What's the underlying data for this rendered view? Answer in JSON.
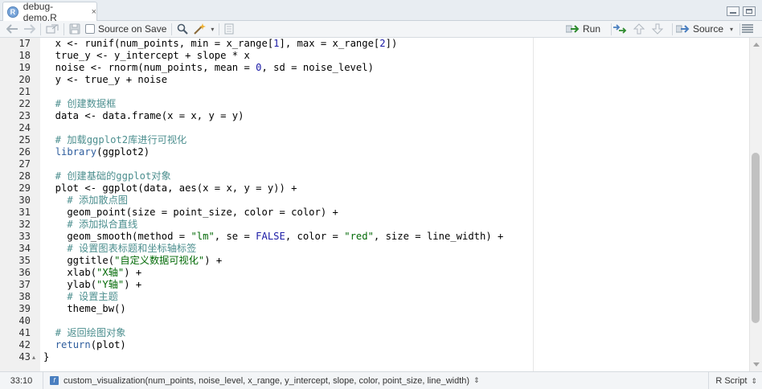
{
  "tab": {
    "file_icon": "R",
    "title": "debug-demo.R",
    "close": "×"
  },
  "toolbar": {
    "source_on_save_label": "Source on Save",
    "run_label": "Run",
    "source_label": "Source"
  },
  "icons": {
    "back": "back-arrow-icon",
    "forward": "forward-arrow-icon",
    "show_in_window": "show-in-window-icon",
    "save": "save-icon",
    "search": "search-icon",
    "code_tools": "magic-wand-icon",
    "compile_report": "notebook-icon",
    "rerun": "rerun-icon",
    "go_up": "go-to-previous-section-icon",
    "go_down": "go-to-next-section-icon"
  },
  "editor": {
    "lines": [
      {
        "n": "17",
        "tokens": [
          [
            "p",
            "  x <- runif(num_points, min = x_range["
          ],
          [
            "n",
            "1"
          ],
          [
            "p",
            "], max = x_range["
          ],
          [
            "n",
            "2"
          ],
          [
            "p",
            "])"
          ]
        ]
      },
      {
        "n": "18",
        "tokens": [
          [
            "p",
            "  true_y <- y_intercept + slope * x"
          ]
        ]
      },
      {
        "n": "19",
        "tokens": [
          [
            "p",
            "  noise <- rnorm(num_points, mean = "
          ],
          [
            "n",
            "0"
          ],
          [
            "p",
            ", sd = noise_level)"
          ]
        ]
      },
      {
        "n": "20",
        "tokens": [
          [
            "p",
            "  y <- true_y + noise"
          ]
        ]
      },
      {
        "n": "21",
        "tokens": []
      },
      {
        "n": "22",
        "tokens": [
          [
            "c",
            "  # 创建数据框"
          ]
        ]
      },
      {
        "n": "23",
        "tokens": [
          [
            "p",
            "  data <- data.frame(x = x, y = y)"
          ]
        ]
      },
      {
        "n": "24",
        "tokens": []
      },
      {
        "n": "25",
        "tokens": [
          [
            "c",
            "  # 加载ggplot2库进行可视化"
          ]
        ]
      },
      {
        "n": "26",
        "tokens": [
          [
            "p",
            "  "
          ],
          [
            "k",
            "library"
          ],
          [
            "p",
            "(ggplot2)"
          ]
        ]
      },
      {
        "n": "27",
        "tokens": []
      },
      {
        "n": "28",
        "tokens": [
          [
            "c",
            "  # 创建基础的ggplot对象"
          ]
        ]
      },
      {
        "n": "29",
        "tokens": [
          [
            "p",
            "  plot <- ggplot(data, aes(x = x, y = y)) +"
          ]
        ]
      },
      {
        "n": "30",
        "tokens": [
          [
            "c",
            "    # 添加散点图"
          ]
        ]
      },
      {
        "n": "31",
        "tokens": [
          [
            "p",
            "    geom_point(size = point_size, color = color) +"
          ]
        ]
      },
      {
        "n": "32",
        "tokens": [
          [
            "c",
            "    # 添加拟合直线"
          ]
        ]
      },
      {
        "n": "33",
        "tokens": [
          [
            "p",
            "    geom_smooth(method = "
          ],
          [
            "s",
            "\"lm\""
          ],
          [
            "p",
            ", se = "
          ],
          [
            "n",
            "FALSE"
          ],
          [
            "p",
            ", color = "
          ],
          [
            "s",
            "\"red\""
          ],
          [
            "p",
            ", size = line_width) +"
          ]
        ]
      },
      {
        "n": "34",
        "tokens": [
          [
            "c",
            "    # 设置图表标题和坐标轴标签"
          ]
        ]
      },
      {
        "n": "35",
        "tokens": [
          [
            "p",
            "    ggtitle("
          ],
          [
            "s",
            "\"自定义数据可视化\""
          ],
          [
            "p",
            ") +"
          ]
        ]
      },
      {
        "n": "36",
        "tokens": [
          [
            "p",
            "    xlab("
          ],
          [
            "s",
            "\"X轴\""
          ],
          [
            "p",
            ") +"
          ]
        ]
      },
      {
        "n": "37",
        "tokens": [
          [
            "p",
            "    ylab("
          ],
          [
            "s",
            "\"Y轴\""
          ],
          [
            "p",
            ") +"
          ]
        ]
      },
      {
        "n": "38",
        "tokens": [
          [
            "c",
            "    # 设置主题"
          ]
        ]
      },
      {
        "n": "39",
        "tokens": [
          [
            "p",
            "    theme_bw()"
          ]
        ]
      },
      {
        "n": "40",
        "tokens": []
      },
      {
        "n": "41",
        "tokens": [
          [
            "c",
            "  # 返回绘图对象"
          ]
        ]
      },
      {
        "n": "42",
        "tokens": [
          [
            "p",
            "  "
          ],
          [
            "k",
            "return"
          ],
          [
            "p",
            "(plot)"
          ]
        ]
      },
      {
        "n": "43",
        "tokens": [
          [
            "p",
            "}"
          ]
        ],
        "fold": "▴"
      }
    ]
  },
  "statusbar": {
    "cursor_position": "33:10",
    "function_icon": "f",
    "scope": "custom_visualization(num_points, noise_level, x_range, y_intercept, slope, color, point_size, line_width)",
    "scope_caret": "⇕",
    "file_type": "R Script",
    "file_type_caret": "⇕"
  },
  "colors": {
    "comment": "#4d8f8f",
    "string": "#036a07",
    "number": "#1a1aa6",
    "keyword": "#2f5e9e"
  }
}
